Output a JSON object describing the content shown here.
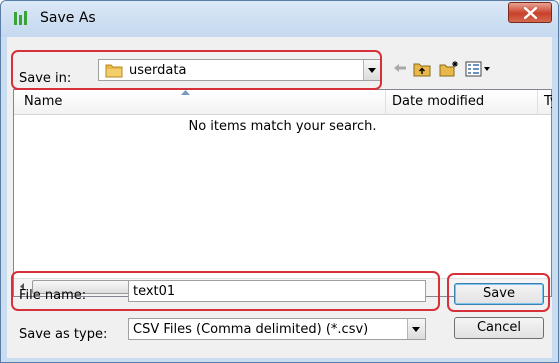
{
  "window": {
    "title": "Save As",
    "icons": {
      "app": "app-icon",
      "close": "close-icon"
    }
  },
  "toolbar": {
    "save_in_label": "Save in:",
    "save_in_value": "userdata",
    "icons": [
      "back-icon",
      "up-folder-icon",
      "new-folder-icon",
      "view-menu-icon"
    ]
  },
  "file_list": {
    "columns": [
      "Name",
      "Date modified",
      "Ty"
    ],
    "empty_message": "No items match your search."
  },
  "form": {
    "file_name_label": "File name:",
    "file_name_value": "text01",
    "save_as_type_label": "Save as type:",
    "save_as_type_value": "CSV Files (Comma delimited) (*.csv)"
  },
  "buttons": {
    "save": "Save",
    "cancel": "Cancel"
  },
  "colors": {
    "highlight": "#d6303a",
    "folder": "#e8b848",
    "title_bar": "#c9dcf0",
    "close_button": "#c7412a"
  }
}
